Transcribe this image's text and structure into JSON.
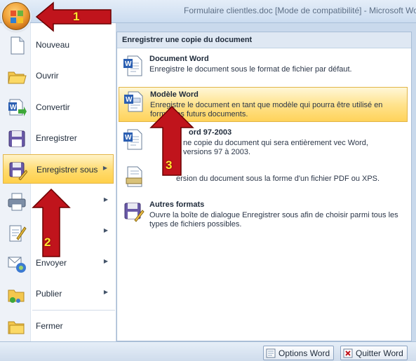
{
  "window": {
    "title": "Formulaire clientles.doc [Mode de compatibilité] - Microsoft Wo"
  },
  "office_button": {
    "icon": "office-logo-icon"
  },
  "left_menu": {
    "items": [
      {
        "label": "Nouveau",
        "icon": "new-document-icon",
        "has_arrow": false
      },
      {
        "label": "Ouvrir",
        "icon": "open-folder-icon",
        "has_arrow": false
      },
      {
        "label": "Convertir",
        "icon": "convert-icon",
        "has_arrow": false
      },
      {
        "label": "Enregistrer",
        "icon": "save-icon",
        "has_arrow": false
      },
      {
        "label": "Enregistrer sous",
        "icon": "save-as-icon",
        "has_arrow": true,
        "active": true
      },
      {
        "label": "",
        "icon": "print-icon",
        "has_arrow": true
      },
      {
        "label": "",
        "icon": "prepare-icon",
        "has_arrow": true
      },
      {
        "label": "Envoyer",
        "icon": "send-icon",
        "has_arrow": true
      },
      {
        "label": "Publier",
        "icon": "publish-icon",
        "has_arrow": true
      },
      {
        "label": "Fermer",
        "icon": "close-folder-icon",
        "has_arrow": false
      }
    ]
  },
  "submenu": {
    "header": "Enregistrer une copie du document",
    "items": [
      {
        "title": "Document Word",
        "description": "Enregistre le document sous le format de fichier par défaut.",
        "icon": "word-document-icon"
      },
      {
        "title": "Modèle Word",
        "description": "Enregistre le document en tant que modèle qui pourra être utilisé en forme des futurs documents.",
        "icon": "word-template-icon",
        "active": true
      },
      {
        "title": "ord 97-2003",
        "description": "ne copie du document qui sera entièrement vec Word, versions 97 à 2003.",
        "icon": "word-97-icon"
      },
      {
        "title": "",
        "description": "ersion du document sous la forme d'un fichier PDF ou XPS.",
        "icon": "pdf-xps-icon"
      },
      {
        "title": "Autres formats",
        "description": "Ouvre la boîte de dialogue Enregistrer sous afin de choisir parmi tous les types de fichiers possibles.",
        "icon": "other-formats-icon"
      }
    ]
  },
  "bottom_bar": {
    "options_label": "Options Word",
    "quit_label": "Quitter Word"
  },
  "annotations": {
    "step1": "1",
    "step2": "2",
    "step3": "3",
    "arrow_color": "#c0141c",
    "number_color": "#ffe830"
  },
  "colors": {
    "highlight": "#ffd35a",
    "panel_header": "#dfe8f3",
    "frame": "#c9d9ec"
  }
}
